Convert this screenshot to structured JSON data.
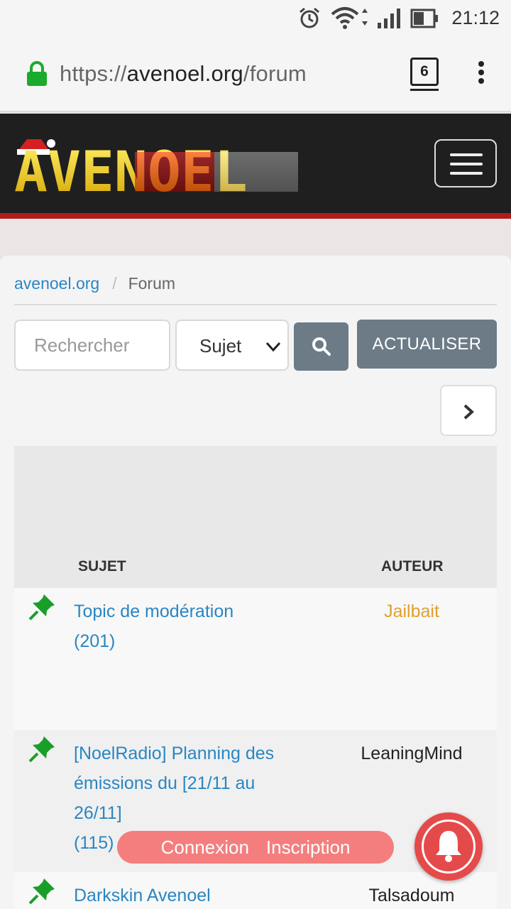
{
  "status_bar": {
    "time": "21:12"
  },
  "browser": {
    "url_scheme": "https://",
    "url_host": "avenoel.org",
    "url_path": "/forum",
    "tab_count": "6"
  },
  "site": {
    "logo_text": "AVENOEL"
  },
  "breadcrumb": {
    "home": "avenoel.org",
    "separator": "/",
    "current": "Forum"
  },
  "search": {
    "placeholder": "Rechercher",
    "field_value": "Sujet",
    "refresh_label": "ACTUALISER"
  },
  "table": {
    "columns": {
      "subject": "SUJET",
      "author": "AUTEUR"
    },
    "rows": [
      {
        "title": "Topic de modération",
        "count": "(201)",
        "author": "Jailbait",
        "author_color": "#e0a030"
      },
      {
        "title": "[NoelRadio] Planning des émissions du [21/11 au 26/11]",
        "count": "(115)",
        "author": "LeaningMind",
        "author_color": "#222222"
      },
      {
        "title": "Darkskin Avenoel",
        "count": "",
        "author": "Talsadoum",
        "author_color": "#222222"
      }
    ]
  },
  "auth": {
    "login": "Connexion",
    "register": "Inscription"
  },
  "colors": {
    "accent": "#2a86c2",
    "header_bg": "#1f1f1f",
    "header_rule": "#b31a1a",
    "button": "#6c7b86",
    "pin": "#1a9e2a"
  }
}
